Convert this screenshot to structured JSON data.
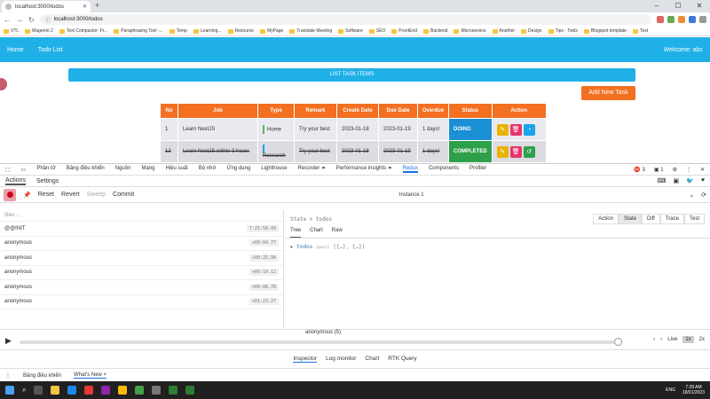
{
  "browser": {
    "tab_title": "localhost:3000/todos",
    "url": "localhost:3000/todos",
    "bookmarks": [
      "VTL",
      "Magento 2",
      "Text Compactor: Fr...",
      "Paraphrasing Tool -...",
      "Temp",
      "Learning...",
      "Resource",
      "MyPage",
      "Translate Meeting",
      "Software",
      "SEO",
      "FrontEnd",
      "Backend",
      "Microservice",
      "Another",
      "Design",
      "Tips - Tools",
      "Blogspot template",
      "Test"
    ]
  },
  "app": {
    "nav_home": "Home",
    "nav_todo": "Todo List",
    "welcome": "Welcome: abc",
    "list_title": "LIST TASK ITEMS",
    "add_button": "Add New Task",
    "columns": [
      "No",
      "Job",
      "Type",
      "Remark",
      "Create Date",
      "Due Date",
      "Overdue",
      "Status",
      "Action"
    ],
    "rows": [
      {
        "no": "1",
        "job": "Learn NextJS",
        "type": "Home",
        "remark": "Try your best",
        "create": "2023-01-18",
        "due": "2023-01-19",
        "overdue": "1 days!",
        "status": "DOING"
      },
      {
        "no": "12",
        "job": "Learn NextJS within 3 hours",
        "type": "Research",
        "remark": "Try your best",
        "create": "2023-01-18",
        "due": "2023-01-19",
        "overdue": "1 days!",
        "status": "COMPLETED"
      }
    ]
  },
  "devtools": {
    "tabs": [
      "Phần tử",
      "Bảng điều khiển",
      "Nguồn",
      "Mạng",
      "Hiệu suất",
      "Bộ nhớ",
      "Ứng dụng",
      "Lighthouse",
      "Recorder ⏶",
      "Performance insights ⏶",
      "Redux",
      "Components",
      "Profiler"
    ],
    "active_tab": "Redux",
    "error_count": "3",
    "msg_count": "1",
    "redux_tabs": [
      "Actions",
      "Settings"
    ],
    "toolbar": {
      "reset": "Reset",
      "revert": "Revert",
      "sweep": "Sweep",
      "commit": "Commit",
      "instance": "Instance 1"
    },
    "filter_placeholder": "filter...",
    "actions": [
      {
        "name": "@@INIT",
        "time": "7:25:58.49"
      },
      {
        "name": "anonymous",
        "time": "+00:04.77"
      },
      {
        "name": "anonymous",
        "time": "+00:25.98"
      },
      {
        "name": "anonymous",
        "time": "+00:10.12"
      },
      {
        "name": "anonymous",
        "time": "+00:08.78"
      },
      {
        "name": "anonymous",
        "time": "+01:23.27"
      }
    ],
    "breadcrumb": "State > todos",
    "view_tabs": [
      "Action",
      "State",
      "Diff",
      "Trace",
      "Test"
    ],
    "active_view": "State",
    "sub_tabs": [
      "Tree",
      "Chart",
      "Raw"
    ],
    "active_sub": "Tree",
    "tree_key": "todos",
    "tree_meta": "(pin)",
    "tree_value": "[{…}, {…}]",
    "slider_label": "anonymous (5)",
    "speed": {
      "live": "Live",
      "one": "1x",
      "two": "2x"
    },
    "bottom_tabs": [
      "Inspector",
      "Log monitor",
      "Chart",
      "RTK Query"
    ],
    "active_bottom": "Inspector",
    "drawer": [
      "Bảng điều khiển",
      "What's New ×"
    ]
  },
  "taskbar": {
    "lang": "ENG",
    "time": "7:28 AM",
    "date": "18/01/2023"
  }
}
